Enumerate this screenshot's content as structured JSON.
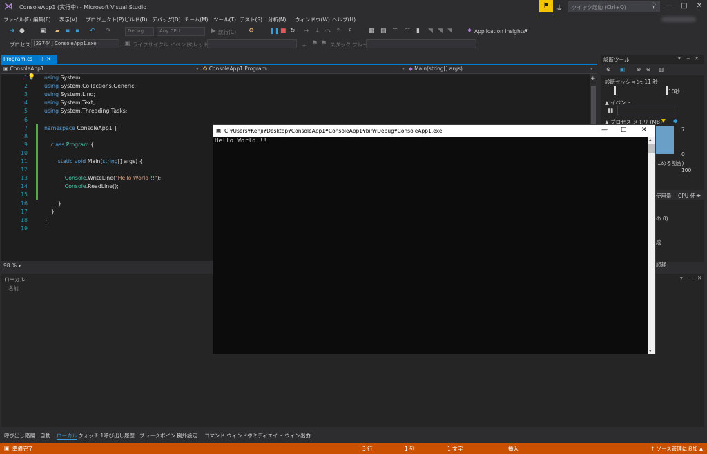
{
  "window": {
    "title": "ConsoleApp1 (実行中) - Microsoft Visual Studio",
    "quick_launch_placeholder": "クイック起動 (Ctrl+Q)",
    "min": "—",
    "max": "□",
    "close": "✕"
  },
  "menu": [
    "ファイル(F)",
    "編集(E)",
    "表示(V)",
    "プロジェクト(P)",
    "ビルド(B)",
    "デバッグ(D)",
    "チーム(M)",
    "ツール(T)",
    "テスト(S)",
    "分析(N)",
    "ウィンドウ(W)",
    "ヘルプ(H)"
  ],
  "toolbar": {
    "config": "Debug",
    "platform": "Any CPU",
    "continue": "続行(C)",
    "app_insights": "Application Insights"
  },
  "toolbar2": {
    "process_label": "プロセス:",
    "process_value": "[23744] ConsoleApp1.exe",
    "lifecycle_label": "ライフサイクル イベント",
    "thread_label": "スレッド:",
    "stackframe_label": "スタック フレーム:"
  },
  "editor": {
    "tab": "Program.cs",
    "nav_project": "ConsoleApp1",
    "nav_class": "ConsoleApp1.Program",
    "nav_member": "Main(string[] args)",
    "zoom": "98 %"
  },
  "code": [
    {
      "n": "1",
      "parts": [
        {
          "c": "kw",
          "t": "using"
        },
        {
          "c": "",
          "t": " System;"
        }
      ]
    },
    {
      "n": "2",
      "parts": [
        {
          "c": "kw",
          "t": "using"
        },
        {
          "c": "",
          "t": " System.Collections.Generic;"
        }
      ]
    },
    {
      "n": "3",
      "parts": [
        {
          "c": "kw",
          "t": "using"
        },
        {
          "c": "",
          "t": " System.Linq;"
        }
      ]
    },
    {
      "n": "4",
      "parts": [
        {
          "c": "kw",
          "t": "using"
        },
        {
          "c": "",
          "t": " System.Text;"
        }
      ]
    },
    {
      "n": "5",
      "parts": [
        {
          "c": "kw",
          "t": "using"
        },
        {
          "c": "",
          "t": " System.Threading.Tasks;"
        }
      ]
    },
    {
      "n": "6",
      "parts": []
    },
    {
      "n": "7",
      "parts": [
        {
          "c": "kw",
          "t": "namespace"
        },
        {
          "c": "",
          "t": " ConsoleApp1 {"
        }
      ]
    },
    {
      "n": "8",
      "parts": []
    },
    {
      "n": "9",
      "parts": [
        {
          "c": "",
          "t": "    "
        },
        {
          "c": "kw",
          "t": "class"
        },
        {
          "c": "",
          "t": " "
        },
        {
          "c": "ty",
          "t": "Program"
        },
        {
          "c": "",
          "t": " {"
        }
      ]
    },
    {
      "n": "10",
      "parts": []
    },
    {
      "n": "11",
      "parts": [
        {
          "c": "",
          "t": "        "
        },
        {
          "c": "kw",
          "t": "static"
        },
        {
          "c": "",
          "t": " "
        },
        {
          "c": "kw",
          "t": "void"
        },
        {
          "c": "",
          "t": " Main("
        },
        {
          "c": "kw",
          "t": "string"
        },
        {
          "c": "",
          "t": "[] args) {"
        }
      ]
    },
    {
      "n": "12",
      "parts": []
    },
    {
      "n": "13",
      "parts": [
        {
          "c": "",
          "t": "            "
        },
        {
          "c": "ty",
          "t": "Console"
        },
        {
          "c": "",
          "t": ".WriteLine("
        },
        {
          "c": "str",
          "t": "\"Hello World !!\""
        },
        {
          "c": "",
          "t": ");"
        }
      ]
    },
    {
      "n": "14",
      "parts": [
        {
          "c": "",
          "t": "            "
        },
        {
          "c": "ty",
          "t": "Console"
        },
        {
          "c": "",
          "t": ".ReadLine();"
        }
      ]
    },
    {
      "n": "15",
      "parts": []
    },
    {
      "n": "16",
      "parts": [
        {
          "c": "",
          "t": "        }"
        }
      ]
    },
    {
      "n": "17",
      "parts": [
        {
          "c": "",
          "t": "    }"
        }
      ]
    },
    {
      "n": "18",
      "parts": [
        {
          "c": "",
          "t": "}"
        }
      ]
    },
    {
      "n": "19",
      "parts": []
    }
  ],
  "console": {
    "title": "C:¥Users¥Kenji¥Desktop¥ConsoleApp1¥ConsoleApp1¥bin¥Debug¥ConsoleApp1.exe",
    "output": "Hello World !!"
  },
  "diag": {
    "title": "診断ツール",
    "session": "診断セッション: 11 秒",
    "ticks": "10秒",
    "events": "▲ イベント",
    "memory": "▲ プロセス メモリ (MB)",
    "mem_hi": "7",
    "mem_lo": "0",
    "cpu_pct": "にめる割合)",
    "cpu_hi": "100",
    "usage_tab": "使用量",
    "cpu_tab": "CPU 使",
    "row1": "の 0)",
    "row2": "成",
    "row3": "記録"
  },
  "locals": {
    "title": "ローカル",
    "col_name": "名前"
  },
  "bottom_tabs": [
    "呼び出し階層",
    "自動",
    "ローカル",
    "ウォッチ 1",
    "呼び出し履歴",
    "ブレークポイント",
    "例外設定",
    "コマンド ウィンドウ",
    "イミディエイト ウィンドウ",
    "出力"
  ],
  "status": {
    "ready": "準備完了",
    "line": "3 行",
    "col": "1 列",
    "ch": "1 文字",
    "mode": "挿入",
    "scm": "↑ ソース管理に追加 ▲"
  },
  "colors": {
    "accent": "#007acc",
    "status": "#ca5100",
    "flag": "#f5c400"
  }
}
